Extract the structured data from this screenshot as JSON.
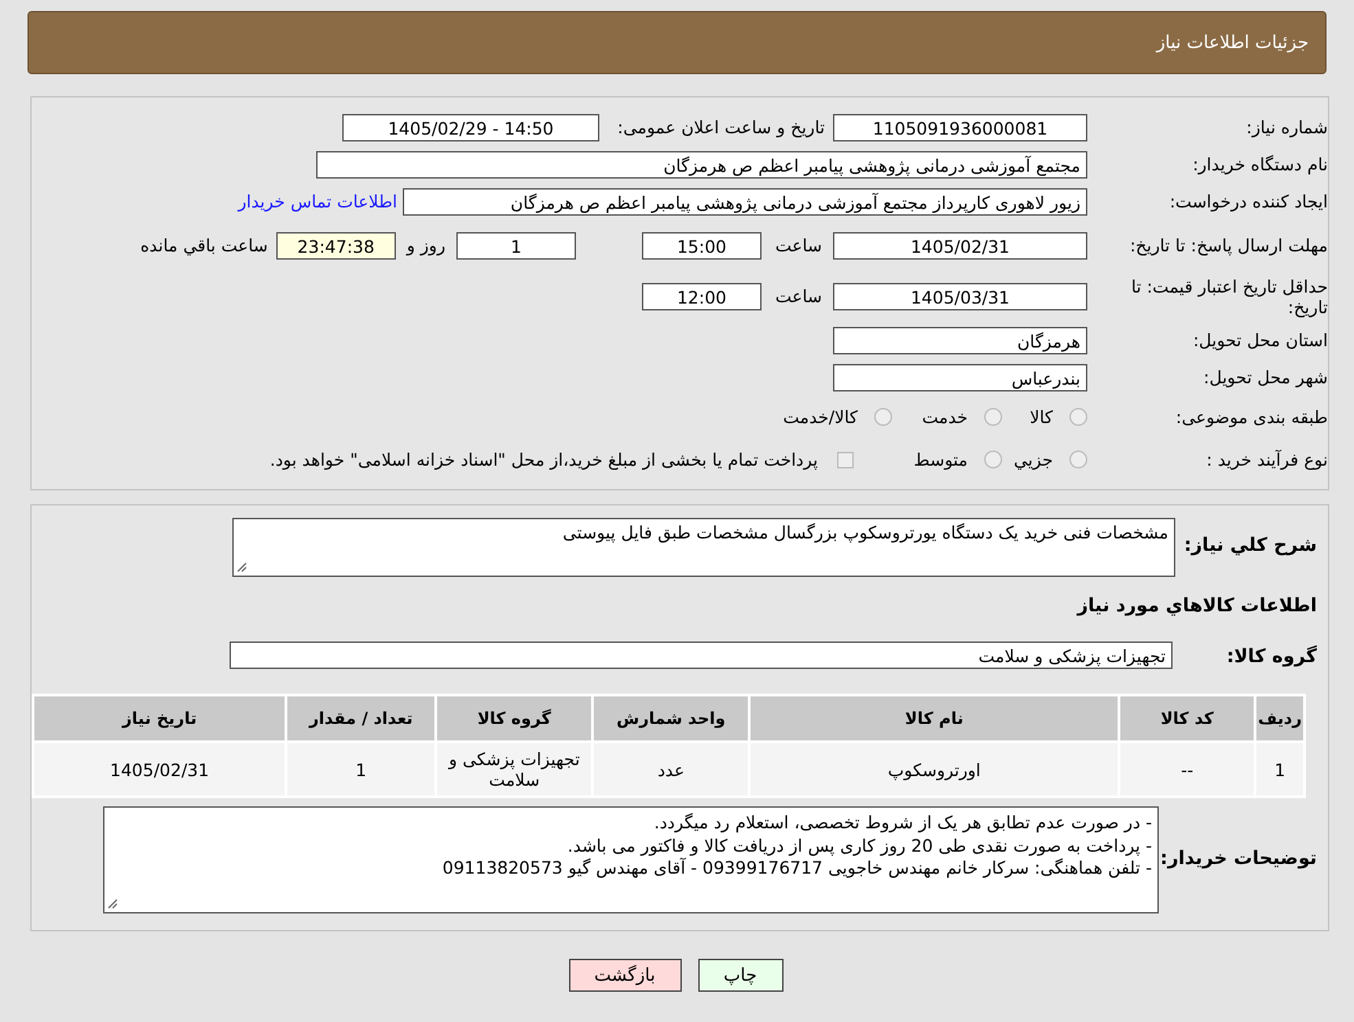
{
  "header": {
    "title": "جزئیات اطلاعات نیاز"
  },
  "details": {
    "need_number": {
      "label": "شماره نیاز:",
      "value": "1105091936000081"
    },
    "announce": {
      "label": "تاریخ و ساعت اعلان عمومی:",
      "value": "1405/02/29 - 14:50"
    },
    "buyer": {
      "label": "نام دستگاه خریدار:",
      "value": "مجتمع آموزشی درمانی پژوهشی پیامبر اعظم ص  هرمزگان"
    },
    "creator": {
      "label": "ایجاد کننده درخواست:",
      "value": "زیور لاهوری کارپرداز مجتمع آموزشی درمانی پژوهشی پیامبر اعظم ص  هرمزگان",
      "link": "اطلاعات تماس خریدار"
    },
    "reply_deadline": {
      "label": "مهلت ارسال پاسخ: تا تاریخ:",
      "date": "1405/02/31",
      "time_label": "ساعت",
      "time": "15:00",
      "days": "1",
      "days_label": "روز و",
      "remaining": "23:47:38",
      "remaining_label": "ساعت باقي مانده"
    },
    "price_validity": {
      "label": "حداقل تاریخ اعتبار قیمت: تا تاریخ:",
      "date": "1405/03/31",
      "time_label": "ساعت",
      "time": "12:00"
    },
    "province": {
      "label": "استان محل تحویل:",
      "value": "هرمزگان"
    },
    "city": {
      "label": "شهر محل تحویل:",
      "value": "بندرعباس"
    },
    "category": {
      "label": "طبقه بندی موضوعی:",
      "options": [
        {
          "label": "كالا",
          "selected": false
        },
        {
          "label": "خدمت",
          "selected": false
        },
        {
          "label": "كالا/خدمت",
          "selected": false
        }
      ]
    },
    "purchase_type": {
      "label": "نوع فرآیند خرید :",
      "options": [
        {
          "label": "جزيي",
          "selected": false
        },
        {
          "label": "متوسط",
          "selected": false
        }
      ],
      "treasury_note": {
        "text": "پرداخت تمام یا بخشی از مبلغ خرید،از محل \"اسناد خزانه اسلامی\" خواهد بود.",
        "checked": false
      }
    }
  },
  "summary": {
    "label": "شرح کلي نياز:",
    "value": "مشخصات فنی خرید یک دستگاه یورتروسکوپ بزرگسال مشخصات طبق فایل پیوستی"
  },
  "goods_heading": "اطلاعات کالاهاي مورد نياز",
  "goods_group": {
    "label": "گروه کالا:",
    "value": "تجهیزات پزشکی و سلامت"
  },
  "table": {
    "columns": [
      "ردیف",
      "کد کالا",
      "نام کالا",
      "واحد شمارش",
      "گروه کالا",
      "تعداد / مقدار",
      "تاریخ نیاز"
    ],
    "rows": [
      [
        "1",
        "--",
        "اورتروسکوپ",
        "عدد",
        "تجهیزات پزشکی و سلامت",
        "1",
        "1405/02/31"
      ]
    ]
  },
  "buyer_notes": {
    "label": "توضیحات خریدار:",
    "lines": [
      "- در صورت عدم تطابق هر یک از شروط تخصصی، استعلام رد میگردد.",
      "- پرداخت به صورت نقدی طی 20 روز کاری پس از دریافت کالا و فاکتور می باشد.",
      "- تلفن هماهنگی: سرکار خانم مهندس خاجویی 09399176717 - آقای مهندس گیو 09113820573"
    ]
  },
  "buttons": [
    {
      "kind": "print",
      "label": "چاپ"
    },
    {
      "kind": "back",
      "label": "بازگشت"
    }
  ]
}
